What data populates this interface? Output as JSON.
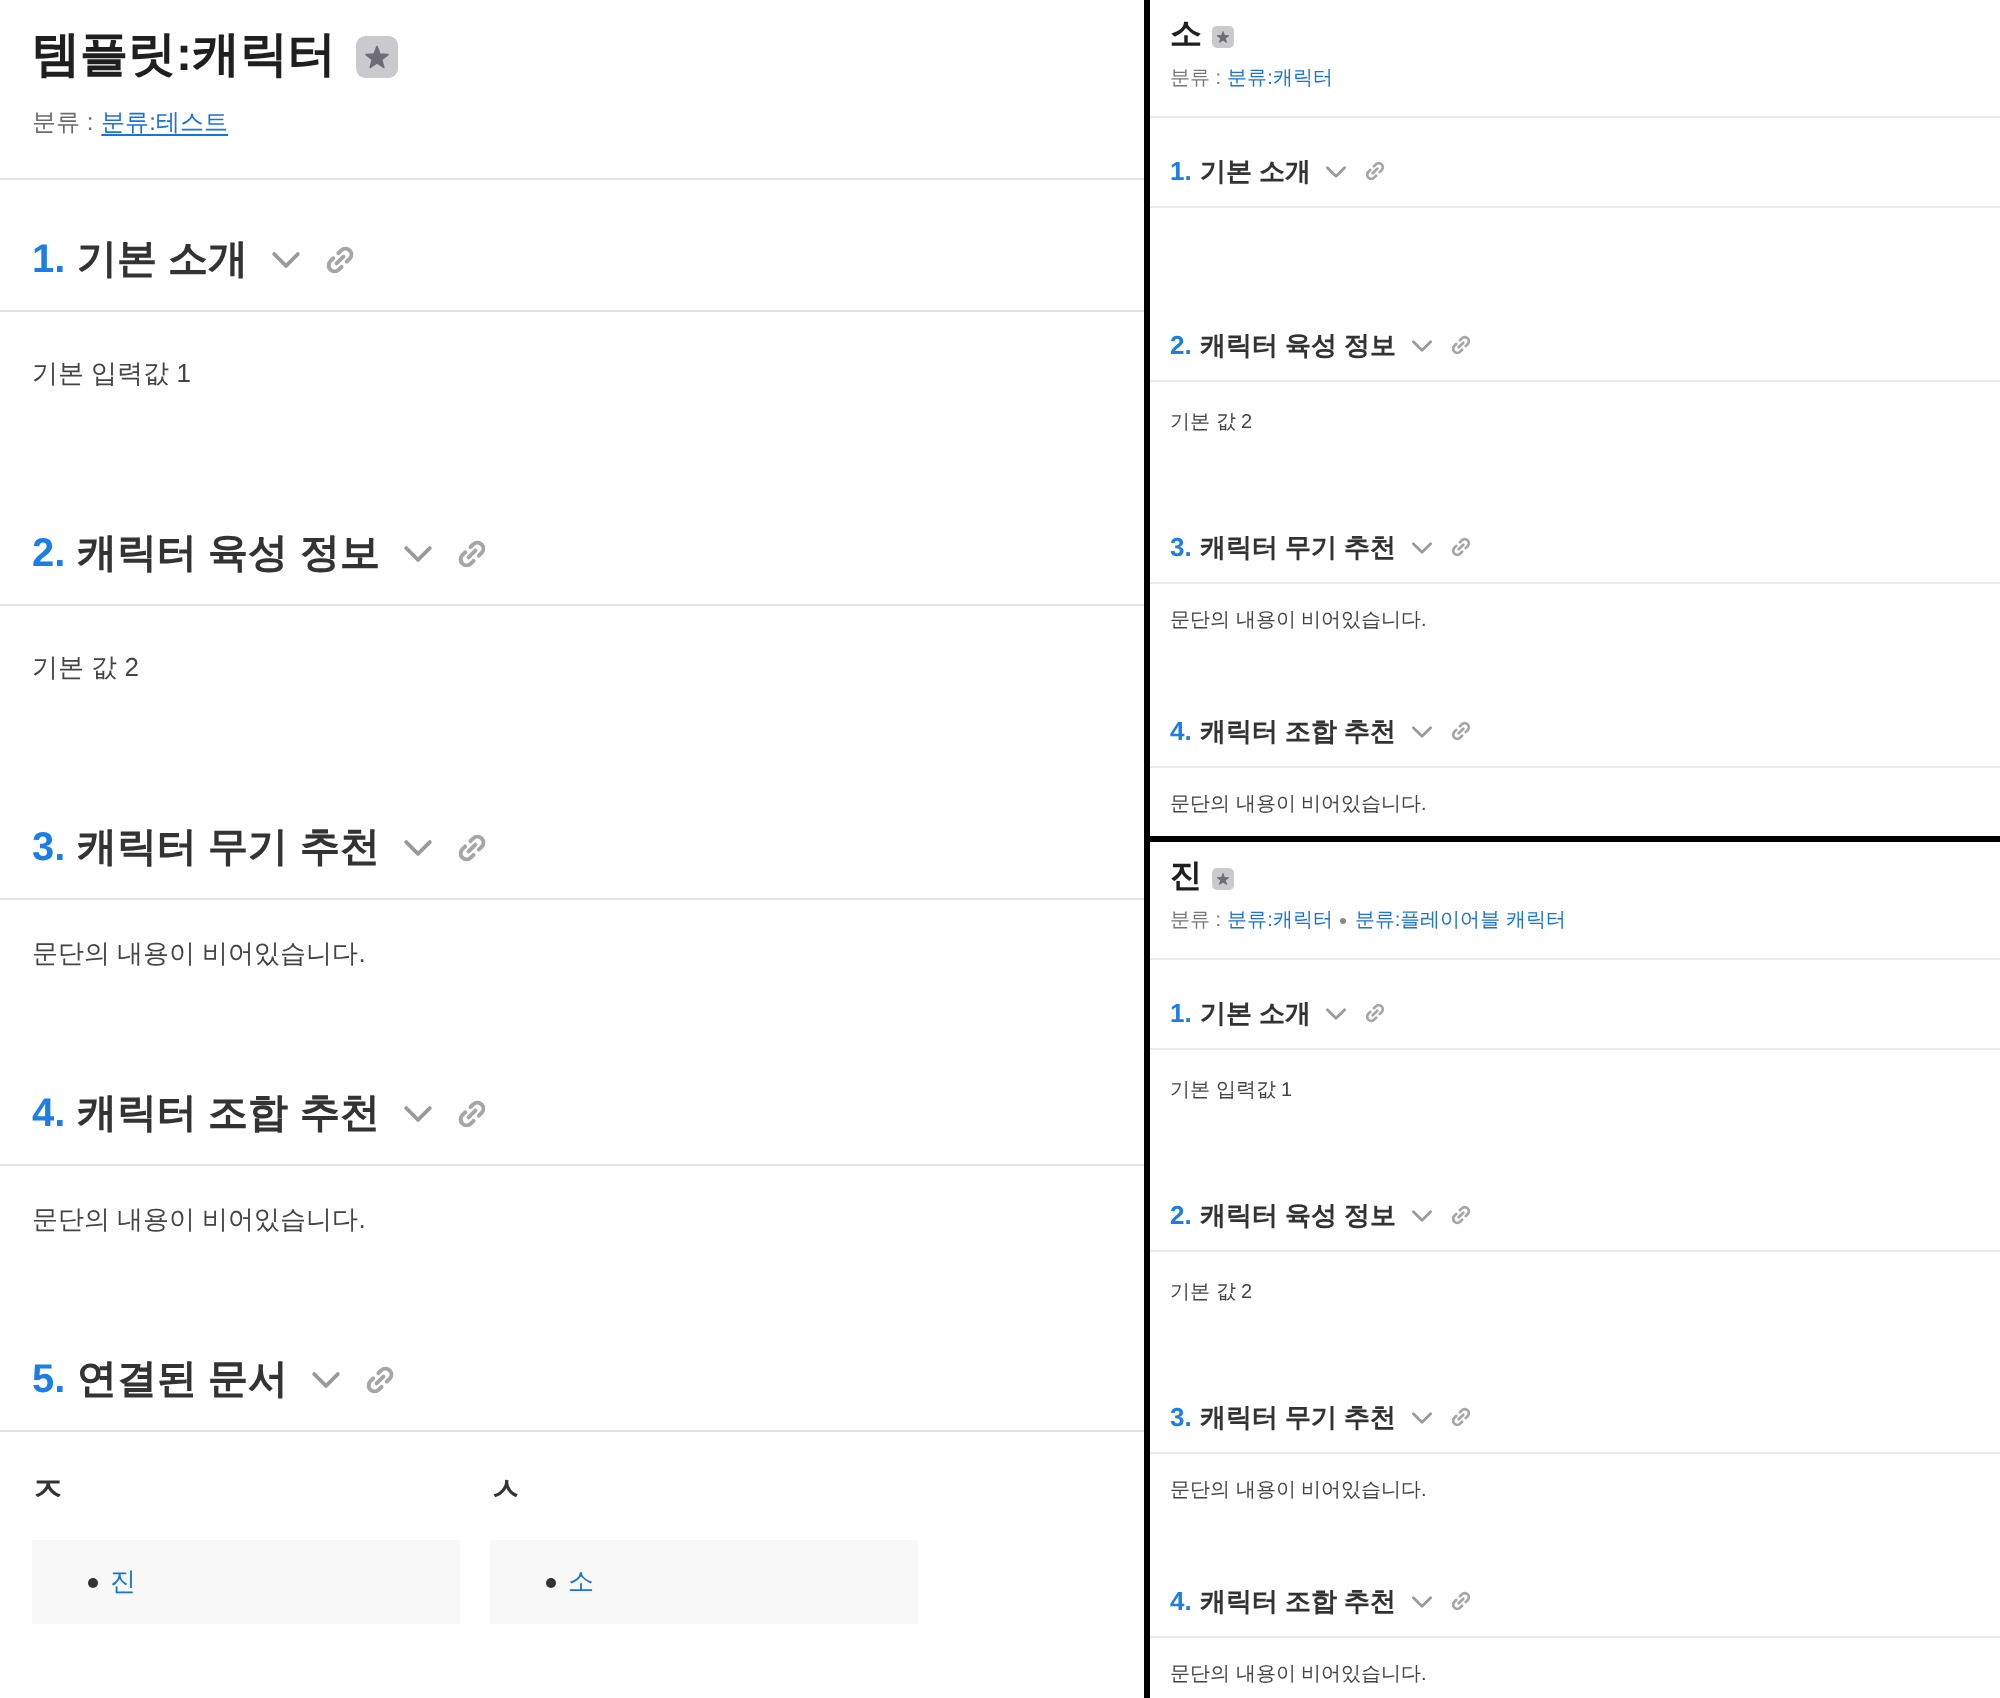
{
  "main_page": {
    "title": "템플릿:캐릭터",
    "category_label": "분류 :",
    "categories": [
      "분류:테스트"
    ],
    "sections": [
      {
        "number": "1.",
        "title": "기본 소개",
        "kind": "text",
        "body": "기본 입력값 1"
      },
      {
        "number": "2.",
        "title": "캐릭터 육성 정보",
        "kind": "text",
        "body": "기본 값 2"
      },
      {
        "number": "3.",
        "title": "캐릭터 무기 추천",
        "kind": "notice",
        "body": "문단의 내용이 비어있습니다."
      },
      {
        "number": "4.",
        "title": "캐릭터 조합 추천",
        "kind": "notice",
        "body": "문단의 내용이 비어있습니다."
      },
      {
        "number": "5.",
        "title": "연결된 문서",
        "kind": "links",
        "groups": [
          {
            "heading": "ㅈ",
            "links": [
              "진"
            ]
          },
          {
            "heading": "ㅅ",
            "links": [
              "소"
            ]
          }
        ]
      }
    ]
  },
  "previews": [
    {
      "title": "소",
      "category_label": "분류 :",
      "categories": [
        "분류:캐릭터"
      ],
      "sections": [
        {
          "number": "1.",
          "title": "기본 소개",
          "kind": "text"
        },
        {
          "number": "2.",
          "title": "캐릭터 육성 정보",
          "kind": "text",
          "body": "기본 값 2"
        },
        {
          "number": "3.",
          "title": "캐릭터 무기 추천",
          "kind": "notice",
          "body": "문단의 내용이 비어있습니다."
        },
        {
          "number": "4.",
          "title": "캐릭터 조합 추천",
          "kind": "notice",
          "body": "문단의 내용이 비어있습니다."
        }
      ]
    },
    {
      "title": "진",
      "category_label": "분류 :",
      "categories": [
        "분류:캐릭터",
        "분류:플레이어블 캐릭터"
      ],
      "sections": [
        {
          "number": "1.",
          "title": "기본 소개",
          "kind": "text",
          "body": "기본 입력값 1"
        },
        {
          "number": "2.",
          "title": "캐릭터 육성 정보",
          "kind": "text",
          "body": "기본 값 2"
        },
        {
          "number": "3.",
          "title": "캐릭터 무기 추천",
          "kind": "notice",
          "body": "문단의 내용이 비어있습니다."
        },
        {
          "number": "4.",
          "title": "캐릭터 조합 추천",
          "kind": "notice",
          "body": "문단의 내용이 비어있습니다."
        }
      ]
    }
  ]
}
